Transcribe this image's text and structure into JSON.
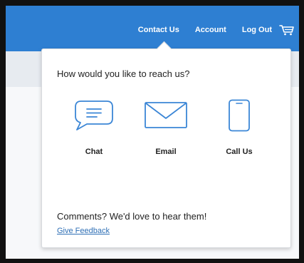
{
  "header": {
    "nav": [
      {
        "label": "Contact Us"
      },
      {
        "label": "Account"
      },
      {
        "label": "Log Out"
      }
    ],
    "cart_icon": "cart-icon"
  },
  "popover": {
    "title": "How would you like to reach us?",
    "options": [
      {
        "label": "Chat",
        "icon": "chat-bubble-icon"
      },
      {
        "label": "Email",
        "icon": "envelope-icon"
      },
      {
        "label": "Call Us",
        "icon": "phone-icon"
      }
    ],
    "comments_text": "Comments? We'd love to hear them!",
    "feedback_link": "Give Feedback"
  },
  "colors": {
    "brand_blue": "#2e7fd2",
    "link_blue": "#2e6fb5",
    "icon_blue": "#3b86d6"
  }
}
